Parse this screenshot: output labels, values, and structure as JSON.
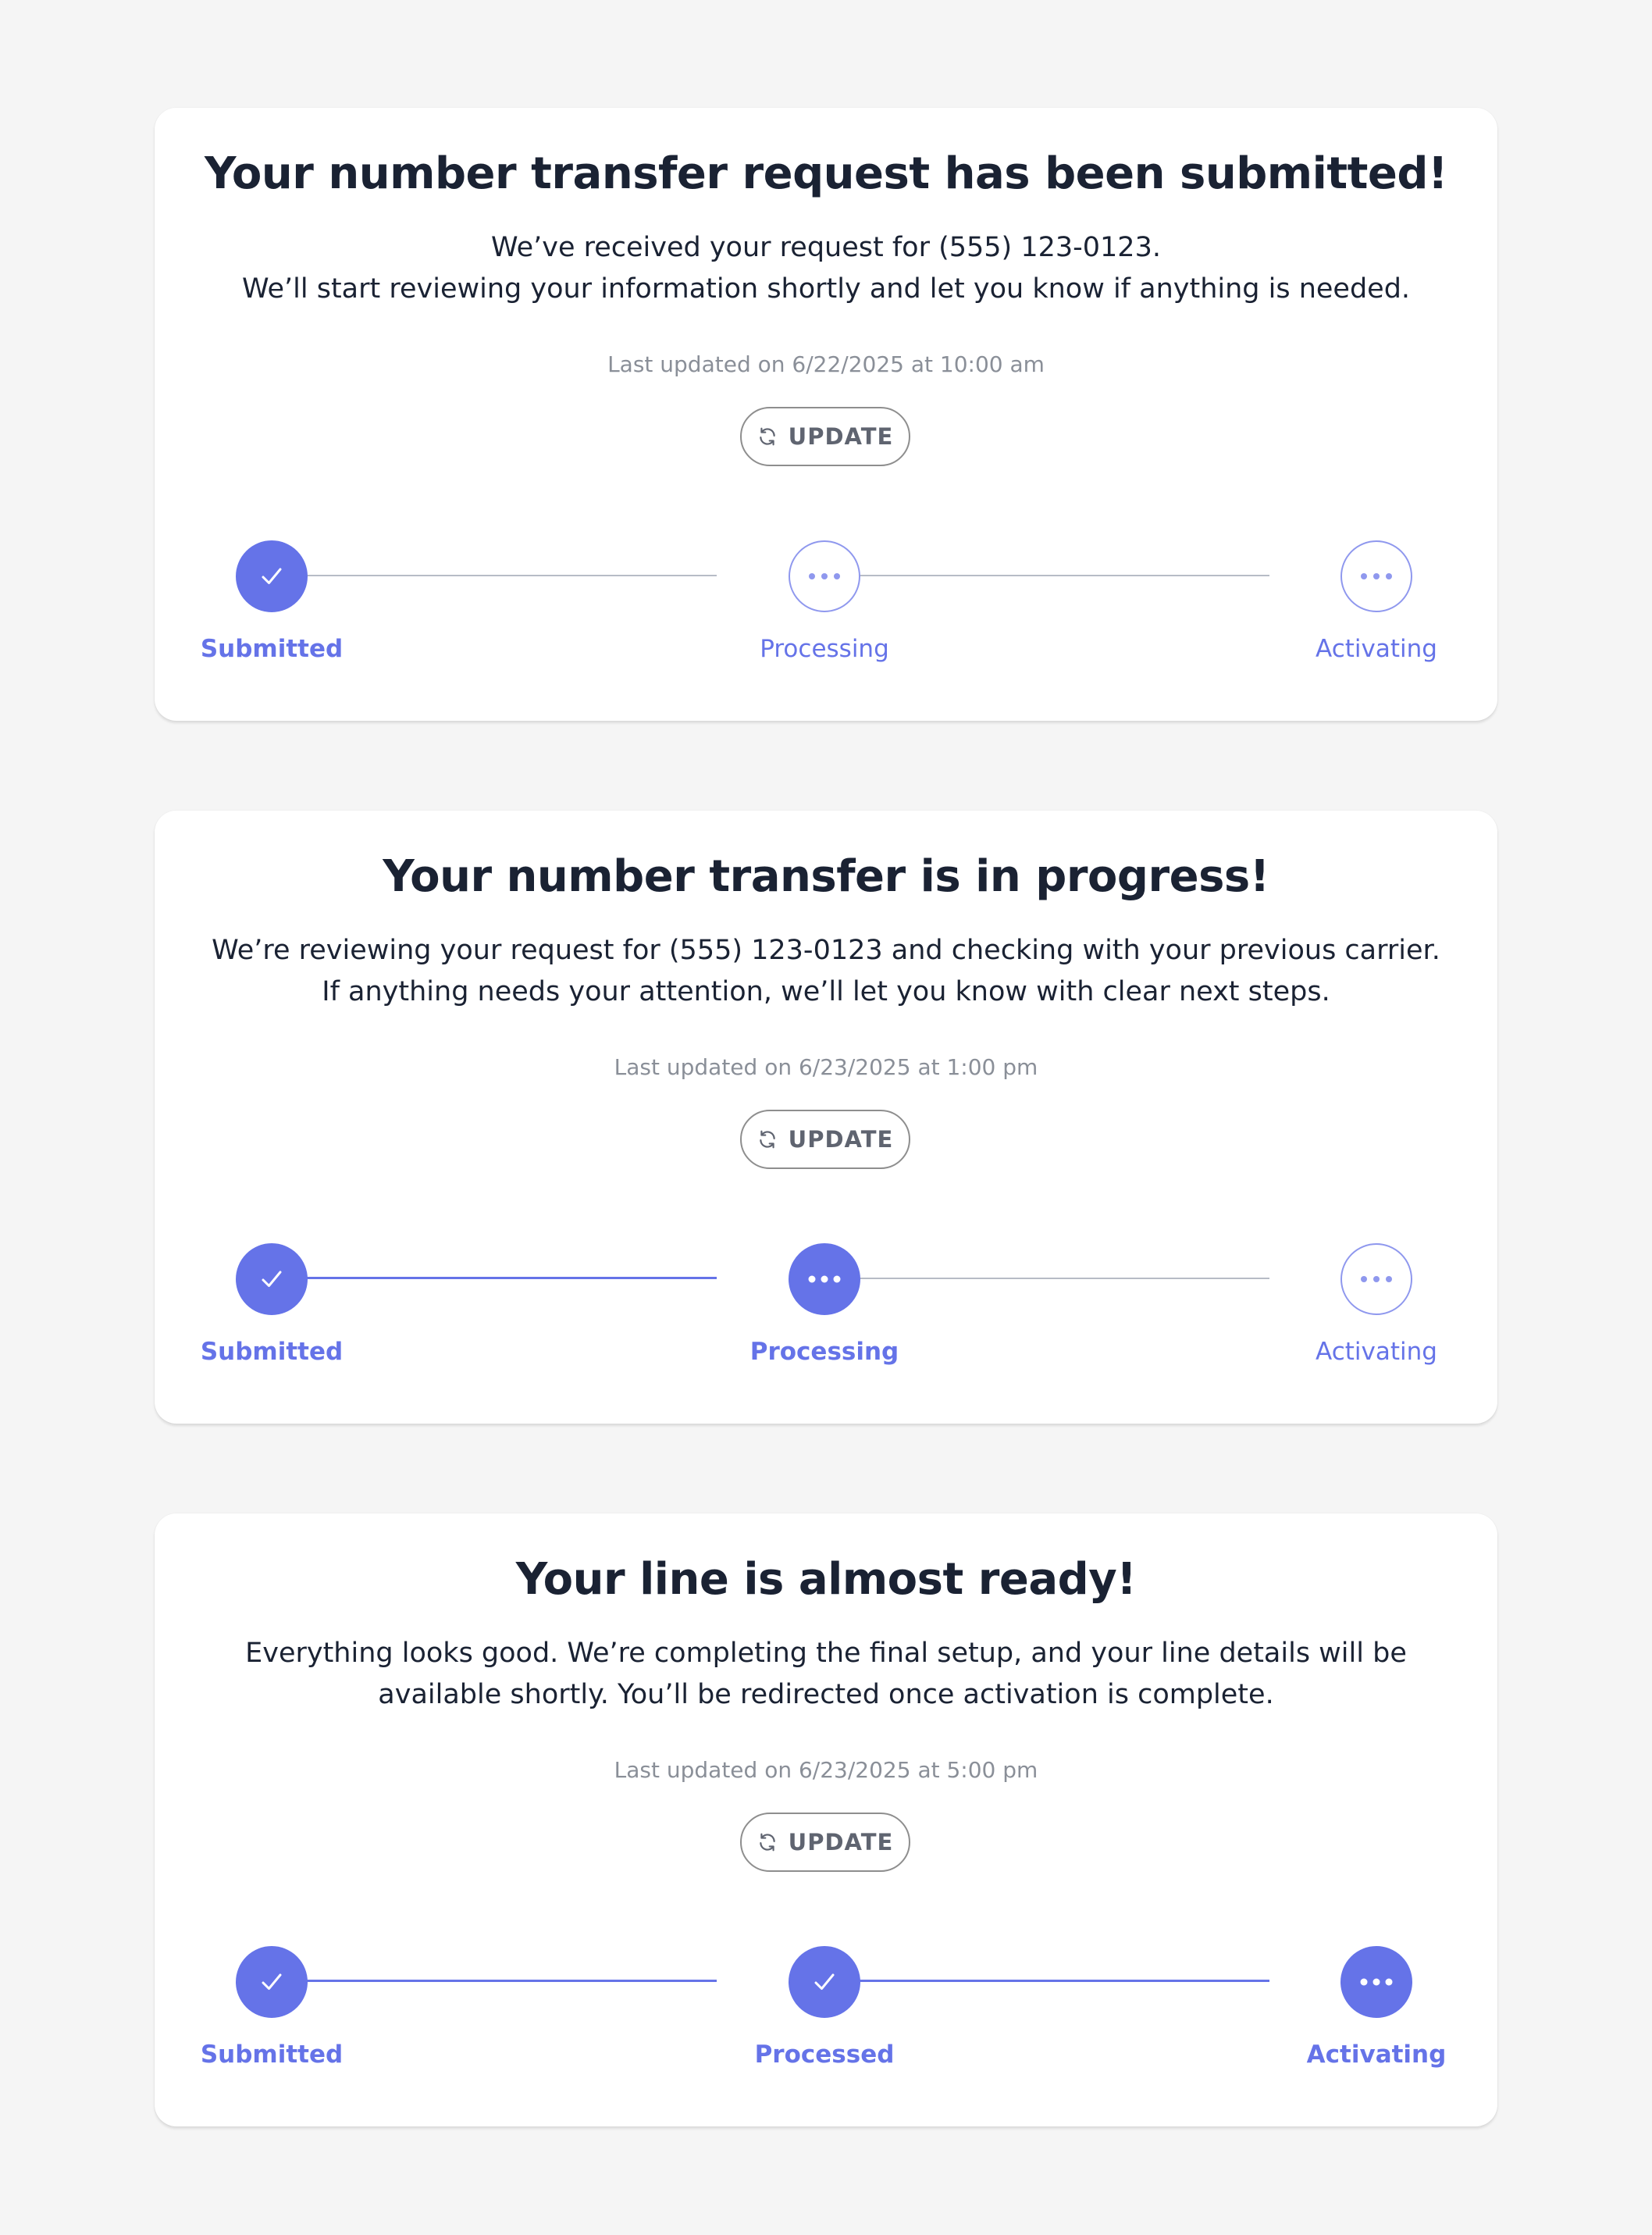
{
  "cards": [
    {
      "title": "Your number transfer request has been submitted!",
      "body_lines": [
        "We’ve received your request for (555) 123-0123.",
        "We’ll start reviewing your information shortly and let you know if anything is needed."
      ],
      "last_updated": "Last updated on 6/22/2025 at 10:00 am",
      "update_label": "UPDATE",
      "steps": [
        {
          "label": "Submitted",
          "status": "complete"
        },
        {
          "label": "Processing",
          "status": "pending"
        },
        {
          "label": "Activating",
          "status": "pending"
        }
      ]
    },
    {
      "title": "Your number transfer is in progress!",
      "body_lines": [
        "We’re reviewing your request for (555) 123-0123 and checking with your previous carrier.",
        "If anything needs your attention, we’ll let you know with clear next steps."
      ],
      "last_updated": "Last updated on 6/23/2025 at 1:00 pm",
      "update_label": "UPDATE",
      "steps": [
        {
          "label": "Submitted",
          "status": "complete"
        },
        {
          "label": "Processing",
          "status": "current"
        },
        {
          "label": "Activating",
          "status": "pending"
        }
      ]
    },
    {
      "title": "Your line is almost ready!",
      "body_lines": [
        "Everything looks good. We’re completing the final setup, and your line details will be",
        "available shortly. You’ll be redirected once activation is complete."
      ],
      "last_updated": "Last updated on 6/23/2025 at 5:00 pm",
      "update_label": "UPDATE",
      "steps": [
        {
          "label": "Submitted",
          "status": "complete"
        },
        {
          "label": "Processed",
          "status": "complete"
        },
        {
          "label": "Activating",
          "status": "current"
        }
      ]
    }
  ],
  "icons": {
    "update": "refresh-icon",
    "complete": "check-icon",
    "pending": "more-dots-icon",
    "current": "more-dots-icon"
  },
  "colors": {
    "accent": "#6573e8",
    "accent_light": "#8f98ee",
    "title": "#1a2233",
    "muted": "#8a8f98",
    "track_inactive": "#b7bcc6",
    "background": "#f5f5f5",
    "card": "#ffffff"
  }
}
